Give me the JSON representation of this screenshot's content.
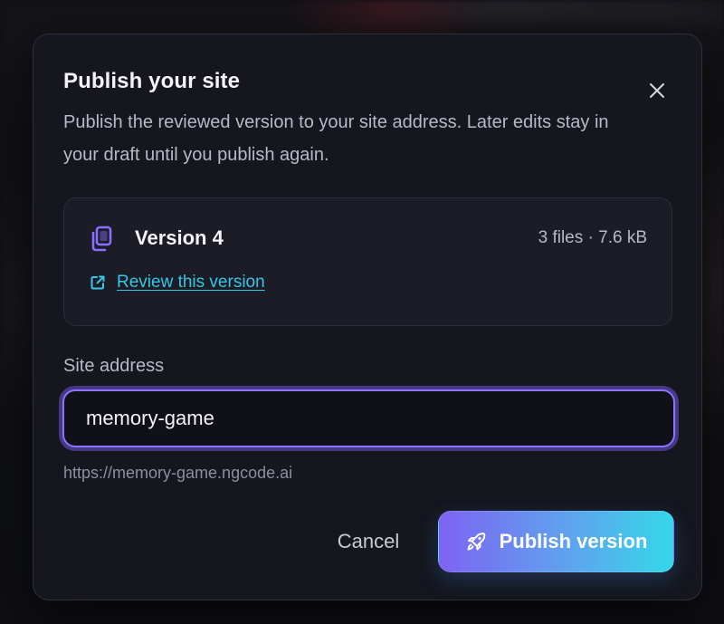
{
  "dialog": {
    "title": "Publish your site",
    "description": "Publish the reviewed version to your site address. Later edits stay in your draft until you publish again."
  },
  "version_card": {
    "icon": "copy-icon",
    "name": "Version 4",
    "meta": "3 files · 7.6 kB",
    "review_link_icon": "external-link-icon",
    "review_link_label": "Review this version"
  },
  "site_address": {
    "label": "Site address",
    "value": "memory-game",
    "url_preview": "https://memory-game.ngcode.ai"
  },
  "actions": {
    "cancel_label": "Cancel",
    "publish_icon": "rocket-icon",
    "publish_label": "Publish version"
  },
  "colors": {
    "accent_purple": "#8f70ff",
    "link_cyan": "#34c7e6",
    "gradient_start": "#7d63f2",
    "gradient_end": "#35d7ea"
  }
}
